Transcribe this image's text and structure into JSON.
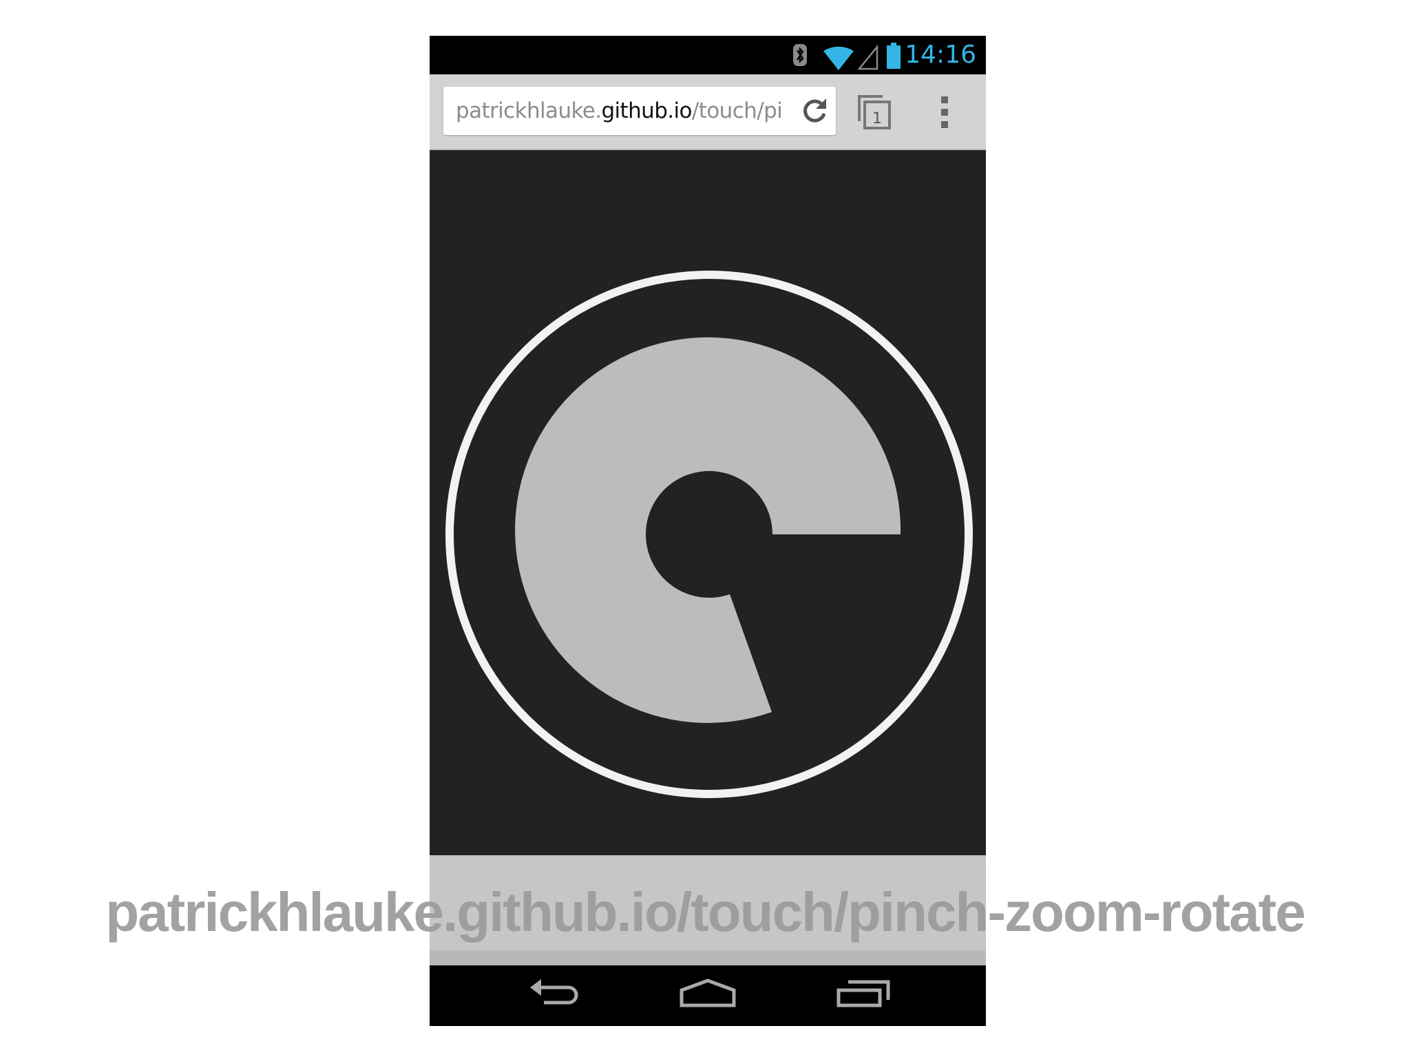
{
  "status_bar": {
    "time": "14:16",
    "icons": [
      "bluetooth-icon",
      "wifi-icon",
      "cell-signal-icon",
      "battery-icon"
    ],
    "clock_color": "#33b5e5"
  },
  "browser": {
    "url_prefix": "patrickhlauke.",
    "url_host": "github.io",
    "url_path": "/touch/pi",
    "tab_count": "1"
  },
  "nav_bar": {
    "icons": [
      "back-icon",
      "home-icon",
      "recent-apps-icon"
    ]
  },
  "caption": {
    "text": "patrickhlauke.github.io/touch/pinch-zoom-rotate"
  },
  "colors": {
    "content_background": "#222222",
    "ring": "#f2f2f2",
    "shape": "#bcbcbc",
    "caption": "#9b9b9b"
  }
}
